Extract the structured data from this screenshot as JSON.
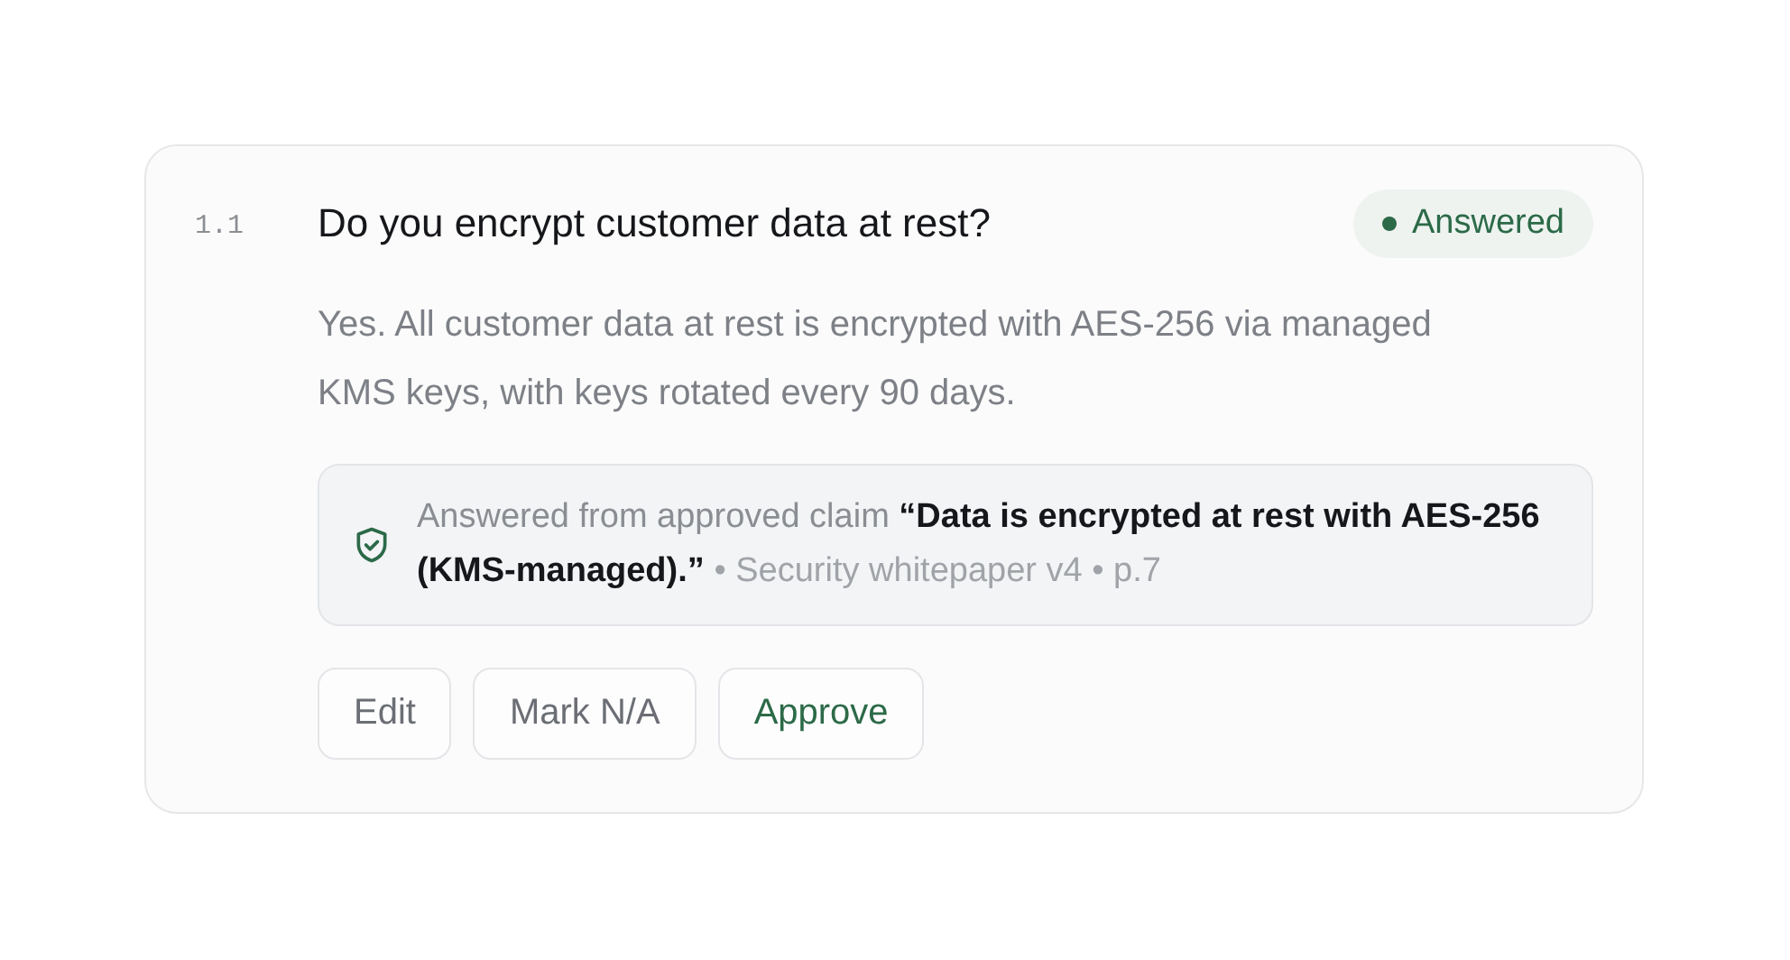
{
  "question": {
    "number": "1.1",
    "text": "Do you encrypt customer data at rest?",
    "status": {
      "label": "Answered",
      "kind": "answered"
    },
    "answer": "Yes. All customer data at rest is encrypted with AES-256 via managed KMS keys, with keys rotated every 90 days.",
    "source": {
      "claim": "Answered from approved claim **“Data is encrypted at rest with AES-256 (KMS-managed).”**",
      "reference": "• Security whitepaper v4 • p.7"
    },
    "actions": [
      {
        "label": "Edit",
        "kind": "secondary"
      },
      {
        "label": "Mark N/A",
        "kind": "secondary"
      },
      {
        "label": "Approve",
        "kind": "approve"
      }
    ]
  }
}
